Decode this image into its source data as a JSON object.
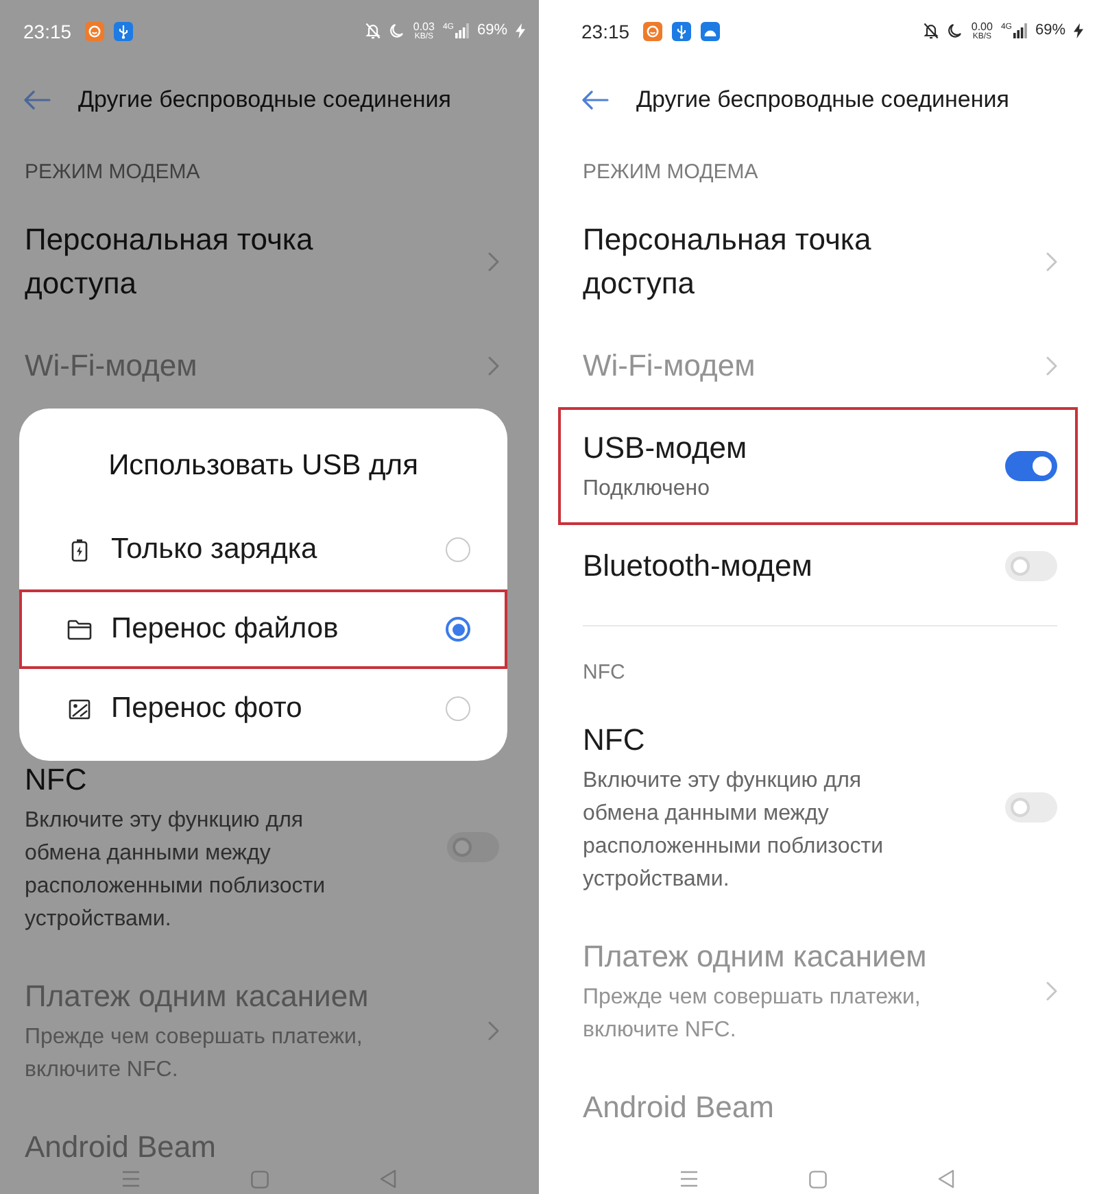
{
  "screens": [
    {
      "dimmed": true,
      "status_bar": {
        "time": "23:15",
        "notifications": [
          {
            "kind": "app"
          },
          {
            "kind": "usb"
          }
        ],
        "speed": "0.03",
        "speed_unit": "KB/S",
        "network": "4G",
        "battery": "69%"
      },
      "header": {
        "title": "Другие беспроводные соединения"
      },
      "content": [
        {
          "kind": "section",
          "label": "РЕЖИМ МОДЕМА"
        },
        {
          "kind": "link",
          "title": "Персональная точка доступа",
          "disabled": false,
          "highlighted": false
        },
        {
          "kind": "link",
          "title": "Wi-Fi-модем",
          "disabled": true,
          "highlighted": false
        },
        {
          "kind": "dialog",
          "title": "Использовать USB для",
          "options": [
            {
              "kind": "battery",
              "label": "Только зарядка",
              "selected": false,
              "highlighted": false
            },
            {
              "kind": "folder",
              "label": "Перенос файлов",
              "selected": true,
              "highlighted": true
            },
            {
              "kind": "image",
              "label": "Перенос фото",
              "selected": false,
              "highlighted": false
            }
          ]
        },
        {
          "kind": "toggle",
          "title": "NFC",
          "description": "Включите эту функцию для обмена данными между расположенными поблизости устройствами.",
          "on": false,
          "disabled": false,
          "highlighted": false
        },
        {
          "kind": "link",
          "title": "Платеж одним касанием",
          "description": "Прежде чем совершать платежи, включите NFC.",
          "disabled": true,
          "highlighted": false
        },
        {
          "kind": "plain",
          "title": "Android Beam",
          "disabled": true,
          "highlighted": false
        }
      ]
    },
    {
      "dimmed": false,
      "status_bar": {
        "time": "23:15",
        "notifications": [
          {
            "kind": "app"
          },
          {
            "kind": "usb"
          },
          {
            "kind": "android"
          }
        ],
        "speed": "0.00",
        "speed_unit": "KB/S",
        "network": "4G",
        "battery": "69%"
      },
      "header": {
        "title": "Другие беспроводные соединения"
      },
      "content": [
        {
          "kind": "section",
          "label": "РЕЖИМ МОДЕМА"
        },
        {
          "kind": "link",
          "title": "Персональная точка доступа",
          "disabled": false,
          "highlighted": false
        },
        {
          "kind": "link",
          "title": "Wi-Fi-модем",
          "disabled": true,
          "highlighted": false
        },
        {
          "kind": "toggle",
          "title": "USB-модем",
          "description": "Подключено",
          "on": true,
          "disabled": false,
          "highlighted": true
        },
        {
          "kind": "toggle",
          "title": "Bluetooth-модем",
          "on": false,
          "disabled": false,
          "highlighted": false
        },
        {
          "kind": "section",
          "label": "NFC"
        },
        {
          "kind": "toggle",
          "title": "NFC",
          "description": "Включите эту функцию для обмена данными между расположенными поблизости устройствами.",
          "on": false,
          "disabled": false,
          "highlighted": false
        },
        {
          "kind": "link",
          "title": "Платеж одним касанием",
          "description": "Прежде чем совершать платежи, включите NFC.",
          "disabled": true,
          "highlighted": false
        },
        {
          "kind": "plain",
          "title": "Android Beam",
          "disabled": true,
          "highlighted": false
        }
      ]
    }
  ]
}
